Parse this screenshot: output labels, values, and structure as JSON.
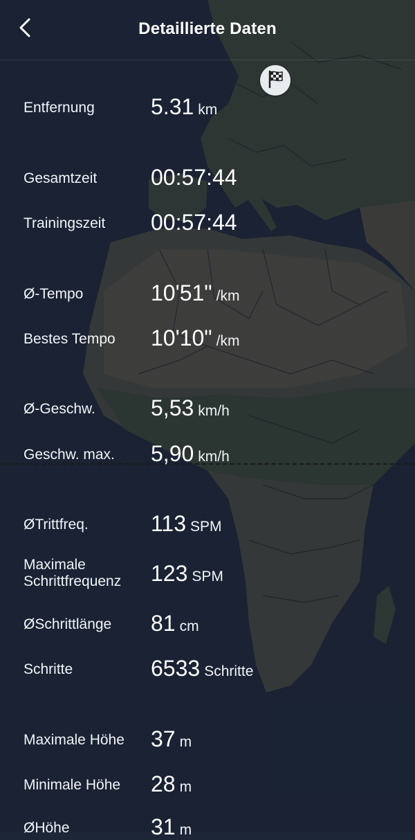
{
  "header": {
    "title": "Detaillierte Daten",
    "back_icon": "chevron-left-icon"
  },
  "map": {
    "marker_icon": "checkered-flag-icon",
    "colors": {
      "ocean": "#1d2636",
      "land": "#3c4636",
      "desert": "#5a5446",
      "border": "#1e2228"
    }
  },
  "stats": [
    {
      "label": "Entfernung",
      "value": "5.31",
      "unit": "km"
    },
    {
      "label": "Gesamtzeit",
      "value": "00:57:44",
      "unit": ""
    },
    {
      "label": "Trainingszeit",
      "value": "00:57:44",
      "unit": ""
    },
    {
      "label": "Ø-Tempo",
      "value": "10'51\"",
      "unit": "/km"
    },
    {
      "label": "Bestes Tempo",
      "value": "10'10\"",
      "unit": "/km"
    },
    {
      "label": "Ø-Geschw.",
      "value": "5,53",
      "unit": "km/h"
    },
    {
      "label": "Geschw. max.",
      "value": "5,90",
      "unit": "km/h"
    },
    {
      "label": "ØTrittfreq.",
      "value": "113",
      "unit": "SPM"
    },
    {
      "label": "Maximale\nSchrittfrequenz",
      "value": "123",
      "unit": "SPM"
    },
    {
      "label": "ØSchrittlänge",
      "value": "81",
      "unit": "cm"
    },
    {
      "label": "Schritte",
      "value": "6533",
      "unit": "Schritte"
    },
    {
      "label": "Maximale Höhe",
      "value": "37",
      "unit": "m"
    },
    {
      "label": "Minimale Höhe",
      "value": "28",
      "unit": "m"
    },
    {
      "label": "ØHöhe",
      "value": "31",
      "unit": "m"
    }
  ]
}
